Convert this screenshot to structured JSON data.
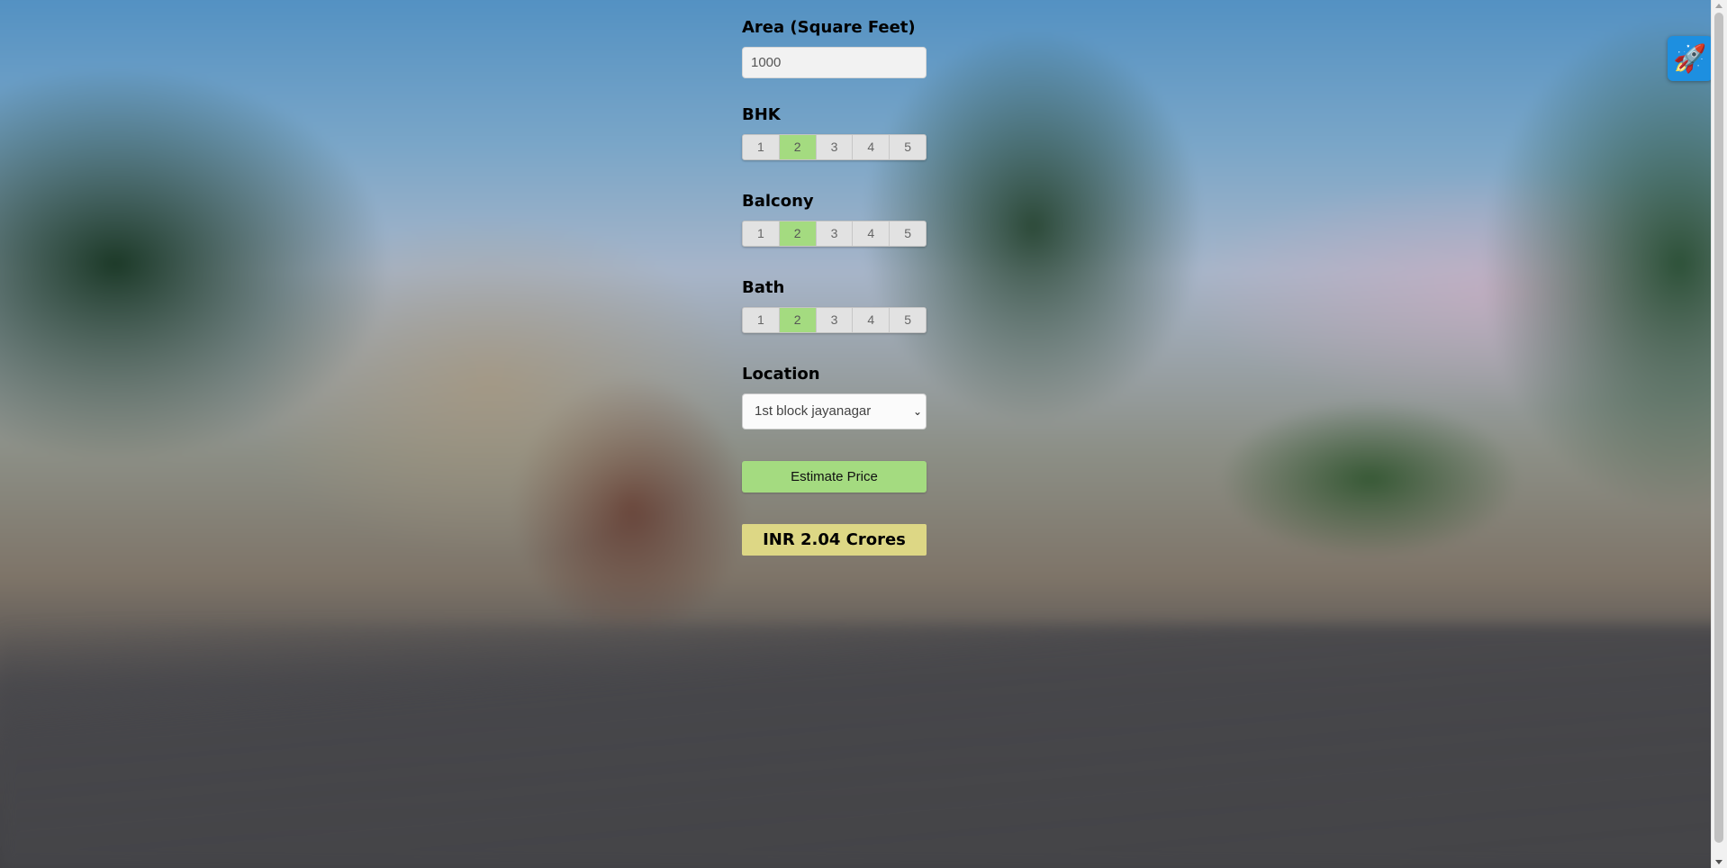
{
  "form": {
    "area": {
      "label": "Area (Square Feet)",
      "value": "1000"
    },
    "bhk": {
      "label": "BHK",
      "options": [
        "1",
        "2",
        "3",
        "4",
        "5"
      ],
      "selected": "2"
    },
    "balcony": {
      "label": "Balcony",
      "options": [
        "1",
        "2",
        "3",
        "4",
        "5"
      ],
      "selected": "2"
    },
    "bath": {
      "label": "Bath",
      "options": [
        "1",
        "2",
        "3",
        "4",
        "5"
      ],
      "selected": "2"
    },
    "location": {
      "label": "Location",
      "value": "1st block jayanagar"
    },
    "estimate_button": "Estimate Price",
    "result": "INR 2.04 Crores"
  },
  "icons": {
    "floating_button": "rocket-icon",
    "select_arrow": "chevron-down-icon"
  },
  "colors": {
    "selected_option": "#a4db80",
    "estimate_button": "#a4db80",
    "result_background": "#ddd785",
    "floating_button": "#1d8fe0"
  }
}
